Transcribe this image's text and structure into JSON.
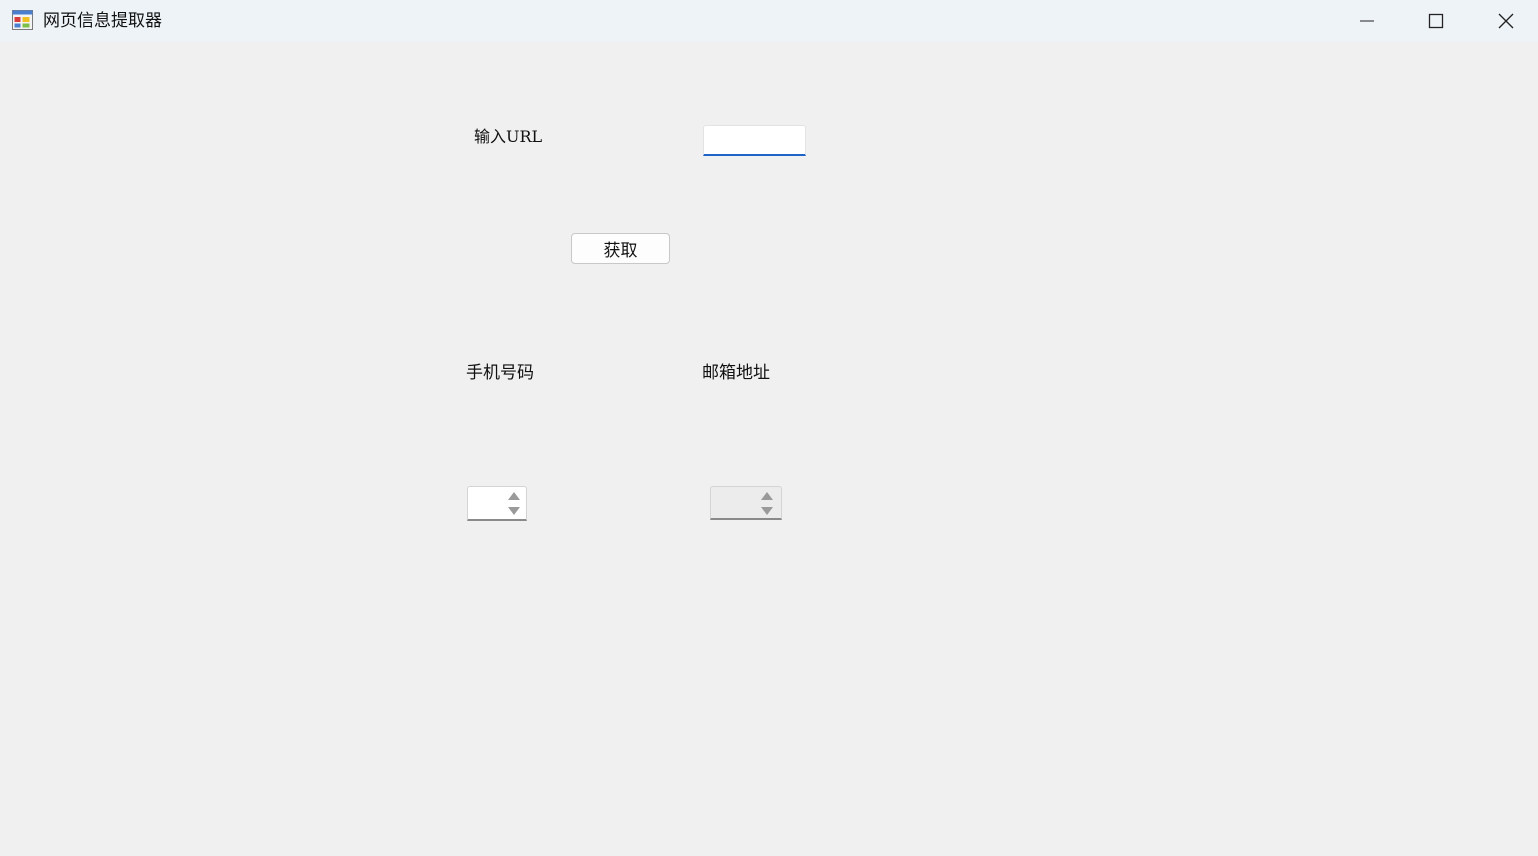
{
  "window": {
    "title": "网页信息提取器",
    "icons": {
      "app": "app-form-icon",
      "minimize": "minimize-icon",
      "maximize": "maximize-icon",
      "close": "close-icon"
    }
  },
  "form": {
    "url_label": "输入URL",
    "url_value": "",
    "fetch_button": "获取",
    "phone_label": "手机号码",
    "phone_value": "",
    "email_label": "邮箱地址",
    "email_value": ""
  },
  "colors": {
    "accent": "#1e64c8",
    "background": "#f0f0f0",
    "titlebar": "#eef3f8"
  }
}
